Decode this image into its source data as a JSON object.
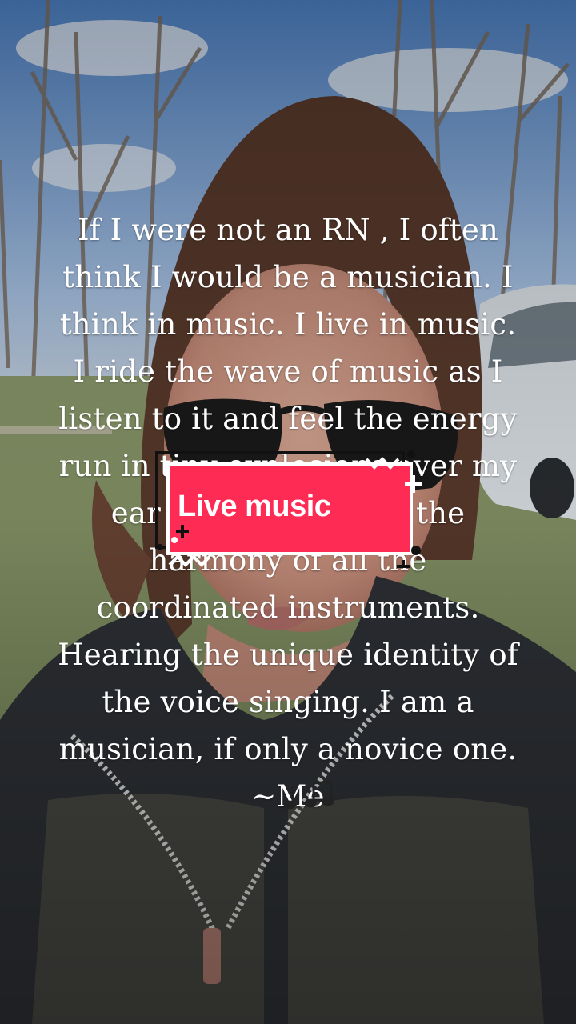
{
  "overlay_text": "If I were not an RN , I often\nthink I would be a musician.  I\nthink in music. I live in music.\nI ride the wave of music as I\nlisten to it and feel the energy\nrun in tiny explosions over my\near drums, notes in the\nharmony of all the\ncoordinated instruments.\nHearing the unique identity of\nthe voice singing. I am a\nmusician, if only a novice one.\n~Me",
  "sticker": {
    "label": "Live music",
    "color": "#fe2c55"
  },
  "icons": [
    "music-notes-icon"
  ],
  "colors": {
    "caption_text": "#ffffff",
    "sticker_fill": "#fe2c55",
    "sticker_outline": "#111111"
  }
}
